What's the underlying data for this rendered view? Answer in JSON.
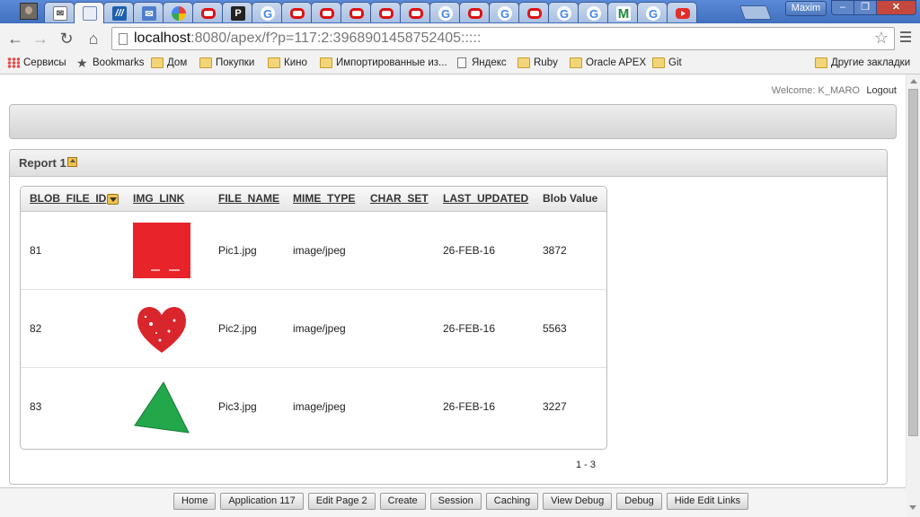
{
  "browser": {
    "profile_name": "Maxim",
    "tab_favicons": [
      "avatar-icon",
      "envelope-icon",
      "page-icon",
      "hp-icon",
      "gmail-icon",
      "photos-icon",
      "oracle-icon",
      "p-icon",
      "google-icon",
      "oracle-icon",
      "oracle-icon",
      "oracle-icon",
      "oracle-icon",
      "oracle-icon",
      "google-icon",
      "oracle-icon",
      "google-icon",
      "oracle-icon",
      "google-icon",
      "google-icon",
      "m-icon",
      "google-icon",
      "youtube-icon"
    ],
    "url_host": "localhost",
    "url_rest": ":8080/apex/f?p=117:2:3968901458752405:::::",
    "bookmarks": [
      {
        "label": "Сервисы",
        "icon": "apps-icon"
      },
      {
        "label": "Bookmarks",
        "icon": "star-icon"
      },
      {
        "label": "Дом",
        "icon": "folder-icon"
      },
      {
        "label": "Покупки",
        "icon": "folder-icon"
      },
      {
        "label": "Кино",
        "icon": "folder-icon"
      },
      {
        "label": "Импортированные из...",
        "icon": "folder-icon"
      },
      {
        "label": "Яндекс",
        "icon": "doc-icon"
      },
      {
        "label": "Ruby",
        "icon": "folder-icon"
      },
      {
        "label": "Oracle APEX",
        "icon": "folder-icon"
      },
      {
        "label": "Git",
        "icon": "folder-icon"
      },
      {
        "label": "Другие закладки",
        "icon": "folder-icon"
      }
    ]
  },
  "header": {
    "welcome": "Welcome: K_MARO",
    "logout": "Logout"
  },
  "region": {
    "title": "Report 1"
  },
  "report": {
    "columns": [
      "BLOB_FILE_ID",
      "IMG_LINK",
      "FILE_NAME",
      "MIME_TYPE",
      "CHAR_SET",
      "LAST_UPDATED",
      "Blob Value"
    ],
    "rows": [
      {
        "id": "81",
        "file_name": "Pic1.jpg",
        "mime": "image/jpeg",
        "charset": "",
        "updated": "26-FEB-16",
        "blob": "3872",
        "img": "red-square"
      },
      {
        "id": "82",
        "file_name": "Pic2.jpg",
        "mime": "image/jpeg",
        "charset": "",
        "updated": "26-FEB-16",
        "blob": "5563",
        "img": "red-heart"
      },
      {
        "id": "83",
        "file_name": "Pic3.jpg",
        "mime": "image/jpeg",
        "charset": "",
        "updated": "26-FEB-16",
        "blob": "3227",
        "img": "green-triangle"
      }
    ],
    "pagination": "1 - 3"
  },
  "dev_toolbar": {
    "buttons": [
      "Home",
      "Application 117",
      "Edit Page 2",
      "Create",
      "Session",
      "Caching",
      "View Debug",
      "Debug",
      "Hide Edit Links"
    ]
  },
  "colors": {
    "pic1": "#e8232a",
    "pic2": "#d9262c",
    "pic3": "#22a84a"
  }
}
